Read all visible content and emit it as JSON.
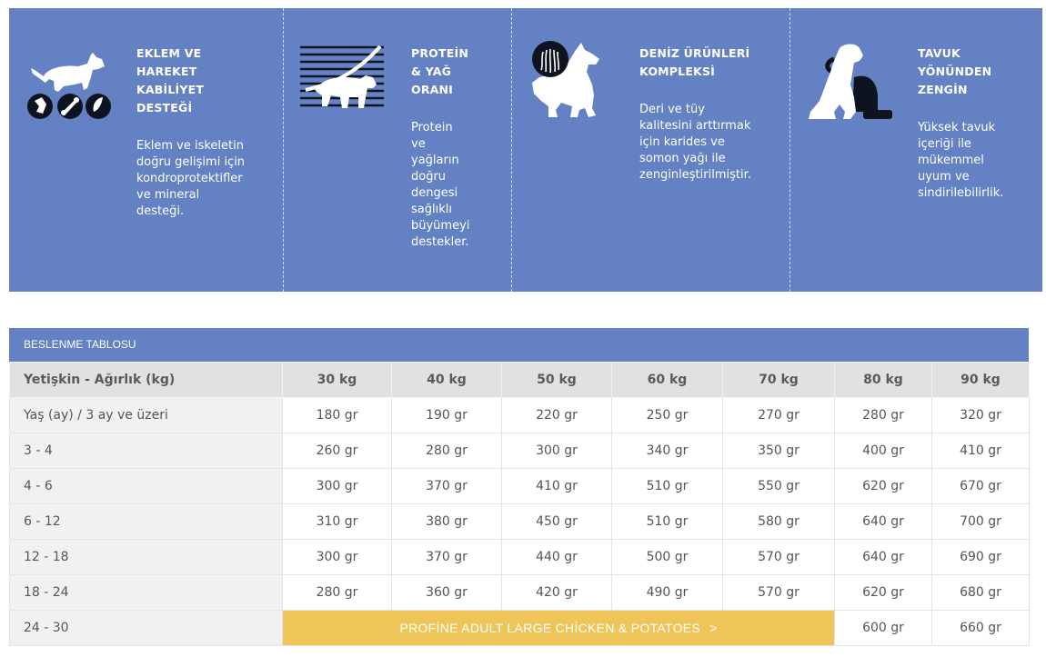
{
  "features": [
    {
      "icon": "dog-joint-bone-icon",
      "title_lines": [
        "EKLEM VE",
        "HAREKET",
        "KABİLİYET",
        "DESTEĞİ"
      ],
      "desc_lines": [
        "Eklem ve iskeletin",
        "doğru gelişimi için",
        "kondroprotektifler",
        "ve mineral",
        "desteği."
      ]
    },
    {
      "icon": "dog-protein-fat-chart-icon",
      "title_lines": [
        "PROTEİN",
        "& YAĞ",
        "ORANI"
      ],
      "desc_lines": [
        "Protein",
        "ve",
        "yağların",
        "doğru",
        "dengesi",
        "sağlıklı",
        "büyümeyi",
        "destekler."
      ]
    },
    {
      "icon": "dog-seafood-coat-icon",
      "title_lines": [
        "DENİZ ÜRÜNLERİ",
        "KOMPLEKSİ"
      ],
      "desc_lines": [
        "Deri ve tüy",
        "kalitesini arttırmak",
        "için karides ve",
        "somon yağı ile",
        "zenginleştirilmiştir."
      ]
    },
    {
      "icon": "dog-food-bowl-icon",
      "title_lines": [
        "TAVUK",
        "YÖNÜNDEN",
        "ZENGİN"
      ],
      "desc_lines": [
        "Yüksek tavuk",
        "içeriği ile",
        "mükemmel",
        "uyum ve",
        "sindirilebilirlik."
      ]
    }
  ],
  "table": {
    "title": "BESLENME TABLOSU",
    "header_label": "Yetişkin - Ağırlık (kg)",
    "columns": [
      "30 kg",
      "40 kg",
      "50 kg",
      "60 kg",
      "70 kg",
      "80 kg",
      "90 kg"
    ],
    "rows": [
      {
        "label": "Yaş (ay) / 3 ay ve üzeri",
        "values": [
          "180 gr",
          "190 gr",
          "220 gr",
          "250 gr",
          "270 gr",
          "280 gr",
          "320 gr"
        ]
      },
      {
        "label": "3 - 4",
        "values": [
          "260 gr",
          "280 gr",
          "300 gr",
          "340 gr",
          "350 gr",
          "400 gr",
          "410 gr"
        ]
      },
      {
        "label": "4 - 6",
        "values": [
          "300 gr",
          "370 gr",
          "410 gr",
          "510 gr",
          "550 gr",
          "620 gr",
          "670 gr"
        ]
      },
      {
        "label": "6 - 12",
        "values": [
          "310 gr",
          "380 gr",
          "450 gr",
          "510 gr",
          "580 gr",
          "640 gr",
          "700 gr"
        ]
      },
      {
        "label": "12 - 18",
        "values": [
          "300 gr",
          "370 gr",
          "440 gr",
          "500 gr",
          "570 gr",
          "640 gr",
          "690 gr"
        ]
      },
      {
        "label": "18 - 24",
        "values": [
          "280 gr",
          "360 gr",
          "420 gr",
          "490 gr",
          "570 gr",
          "620 gr",
          "680 gr"
        ]
      },
      {
        "label": "24 - 30",
        "values": [
          "600 gr",
          "660 gr"
        ]
      }
    ],
    "promo": {
      "label": "PROFİNE ADULT LARGE CHİCKEN & POTATOES",
      "chevron": ">"
    }
  },
  "colors": {
    "band": "#6482c3",
    "header_bg": "#e1e1e1",
    "label_bg": "#f1f1f1",
    "promo": "#eec558"
  }
}
